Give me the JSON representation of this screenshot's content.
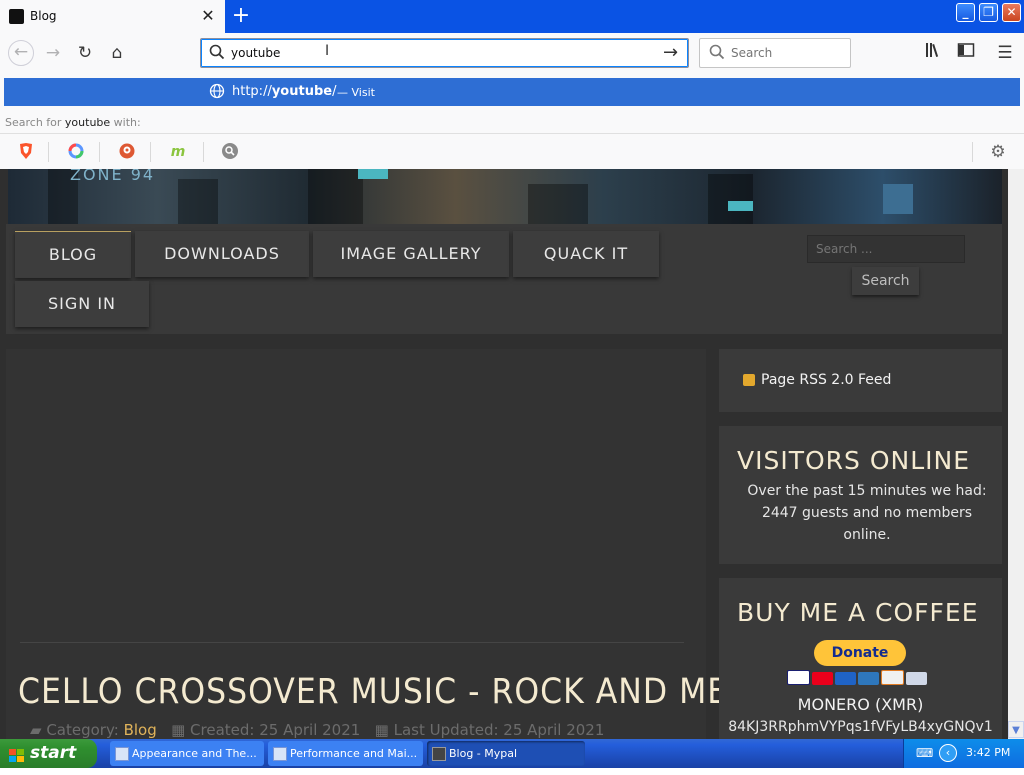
{
  "browser": {
    "tab_title": "Blog",
    "tab_close": "✕",
    "new_tab": "+",
    "url_value": "youtube",
    "search_placeholder": "Search",
    "window_min": "_",
    "window_max": "❐",
    "window_close": "✕"
  },
  "dropdown": {
    "suggestion_url_prefix": "http://",
    "suggestion_url_bold": "youtube",
    "suggestion_url_suffix": "/",
    "suggestion_action": "— Visit",
    "search_for_prefix": "Search for",
    "search_for_term": "youtube",
    "search_for_suffix": "with:"
  },
  "site": {
    "banner_text": "ZONE 94",
    "menu": [
      "BLOG",
      "DOWNLOADS",
      "IMAGE GALLERY",
      "QUACK IT",
      "SIGN IN"
    ],
    "search_placeholder": "Search ...",
    "search_button": "Search"
  },
  "article": {
    "title": "CELLO CROSSOVER MUSIC - ROCK AND METAL",
    "category_label": "Category:",
    "category_value": "Blog",
    "created": "Created: 25 April 2021",
    "updated": "Last Updated: 25 April 2021"
  },
  "sidebar": {
    "rss": "Page RSS 2.0 Feed",
    "visitors_title": "VISITORS ONLINE",
    "visitors_text": "Over the past 15 minutes we had: 2447 guests and no members online.",
    "coffee_title": "BUY ME A COFFEE",
    "donate": "Donate",
    "monero_label": "MONERO (XMR)",
    "monero_address": "84KJ3RRphmVYPqs1fVFyLB4xyGNQv1"
  },
  "taskbar": {
    "start": "start",
    "tasks": [
      "Appearance and The...",
      "Performance and Mai...",
      "Blog - Mypal"
    ],
    "clock": "3:42 PM"
  },
  "colors": {
    "accent_blue": "#2e6ed4",
    "titlebar_blue": "#0a53e4",
    "page_bg": "#2f2f2f",
    "heading_cream": "#f4ead0",
    "link_gold": "#e0b35a",
    "donate_yellow": "#ffc439",
    "taskbar_blue": "#245edb",
    "start_green": "#2f8f2f"
  },
  "icons": {
    "back": "back-arrow-icon",
    "forward": "forward-arrow-icon",
    "reload": "reload-icon",
    "home": "home-icon",
    "search": "magnifier-icon",
    "go": "go-arrow-icon",
    "library": "library-icon",
    "sidebar": "sidebar-icon",
    "menu": "hamburger-menu-icon",
    "globe": "globe-icon",
    "rss": "rss-icon",
    "settings": "gear-icon"
  }
}
